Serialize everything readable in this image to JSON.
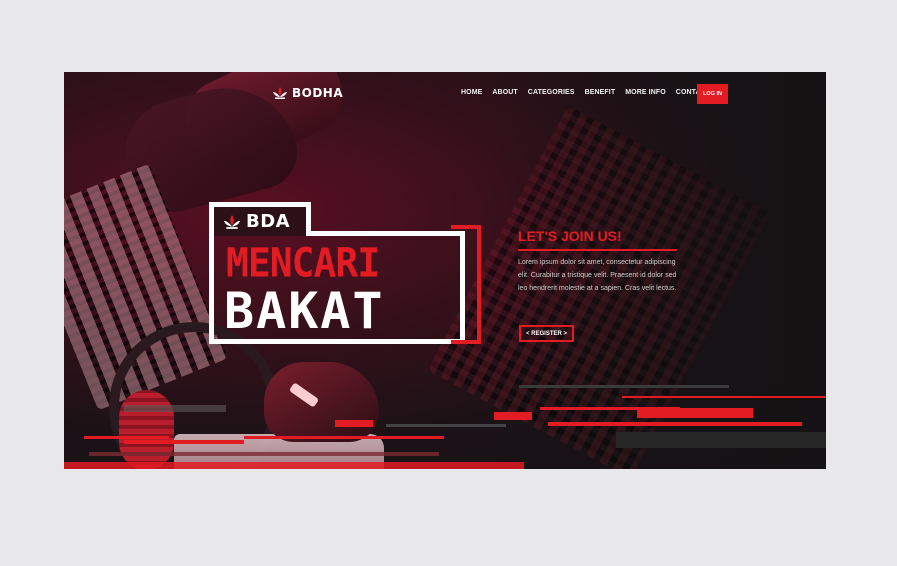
{
  "brand": {
    "name": "BODHA"
  },
  "nav": {
    "items": [
      "HOME",
      "ABOUT",
      "CATEGORIES",
      "BENEFIT",
      "MORE INFO",
      "CONTACTS"
    ],
    "login_label": "LOG IN"
  },
  "hero": {
    "badge_text": "BDA",
    "title_line1": "MENCARI",
    "title_line2": "BAKAT",
    "join_heading": "LET'S JOIN US!",
    "paragraph": "Lorem ipsum dolor sit amet, consectetur adipiscing elit. Curabitur a tristique velit. Praesent id dolor sed leo hendrerit molestie at a sapien. Cras velit lectus.",
    "register_label": "< REGISTER >"
  },
  "colors": {
    "accent": "#e31b23",
    "background": "#161316",
    "page": "#e8e8ea"
  }
}
